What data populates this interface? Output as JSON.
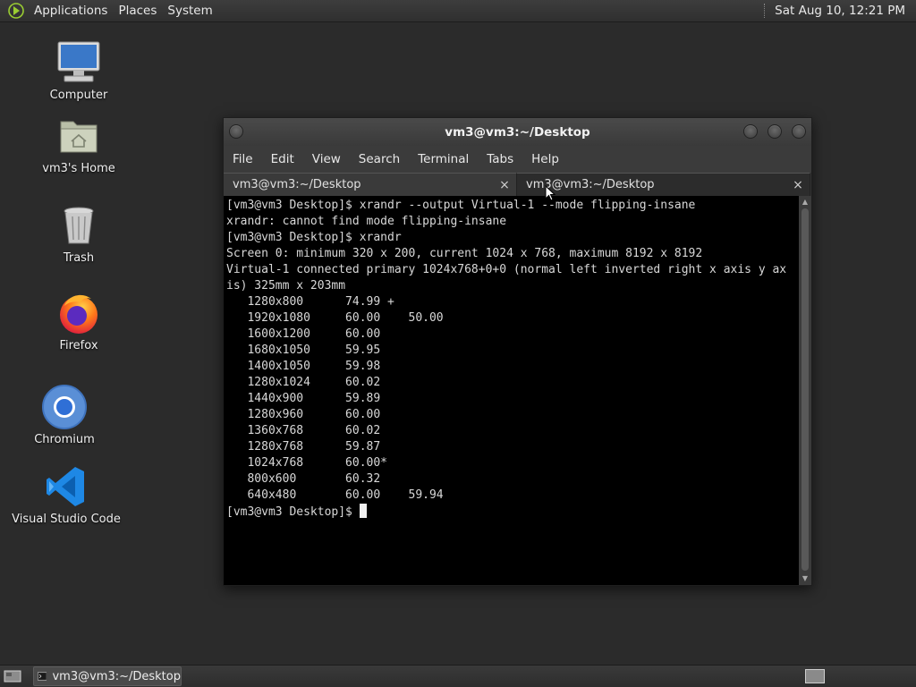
{
  "top_panel": {
    "menus": [
      "Applications",
      "Places",
      "System"
    ],
    "clock": "Sat Aug 10, 12:21 PM"
  },
  "desktop_icons": [
    {
      "label": "Computer",
      "icon": "computer-icon"
    },
    {
      "label": "vm3's Home",
      "icon": "home-folder-icon"
    },
    {
      "label": "Trash",
      "icon": "trash-icon"
    },
    {
      "label": "Firefox",
      "icon": "firefox-icon"
    },
    {
      "label": "Chromium",
      "icon": "chromium-icon"
    },
    {
      "label": "Visual Studio Code",
      "icon": "vscode-icon"
    }
  ],
  "window": {
    "title": "vm3@vm3:~/Desktop",
    "menu": [
      "File",
      "Edit",
      "View",
      "Search",
      "Terminal",
      "Tabs",
      "Help"
    ],
    "tabs": [
      {
        "label": "vm3@vm3:~/Desktop",
        "close": "×"
      },
      {
        "label": "vm3@vm3:~/Desktop",
        "close": "×"
      }
    ],
    "terminal_lines": [
      "[vm3@vm3 Desktop]$ xrandr --output Virtual-1 --mode flipping-insane",
      "xrandr: cannot find mode flipping-insane",
      "[vm3@vm3 Desktop]$ xrandr",
      "Screen 0: minimum 320 x 200, current 1024 x 768, maximum 8192 x 8192",
      "Virtual-1 connected primary 1024x768+0+0 (normal left inverted right x axis y ax",
      "is) 325mm x 203mm",
      "   1280x800      74.99 +",
      "   1920x1080     60.00    50.00",
      "   1600x1200     60.00",
      "   1680x1050     59.95",
      "   1400x1050     59.98",
      "   1280x1024     60.02",
      "   1440x900      59.89",
      "   1280x960      60.00",
      "   1360x768      60.02",
      "   1280x768      59.87",
      "   1024x768      60.00*",
      "   800x600       60.32",
      "   640x480       60.00    59.94"
    ],
    "prompt": "[vm3@vm3 Desktop]$ "
  },
  "taskbar": {
    "task_label": "vm3@vm3:~/Desktop"
  },
  "colors": {
    "desktop_bg": "#2b2b2b",
    "terminal_bg": "#000000",
    "terminal_fg": "#d8d8d8"
  }
}
